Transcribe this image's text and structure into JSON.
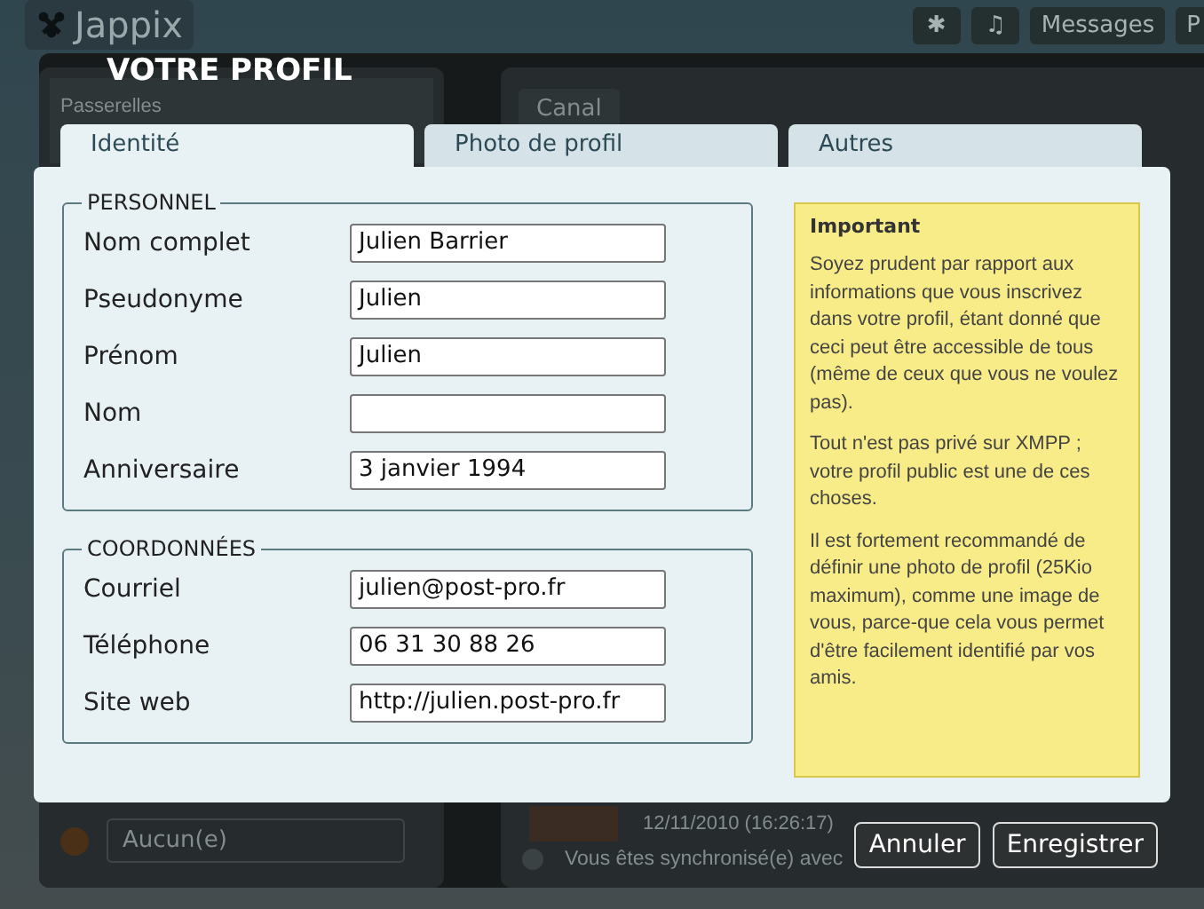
{
  "background_app": {
    "logo": "Jappix",
    "toolbar": [
      {
        "kind": "icon",
        "label": "✱"
      },
      {
        "kind": "icon",
        "label": "♫"
      },
      {
        "kind": "text",
        "label": "Messages"
      },
      {
        "kind": "text",
        "label": "P"
      }
    ],
    "left_panel": {
      "section": "Passerelles",
      "presence_select": "Aucun(e)"
    },
    "right_panel": {
      "tab": "Canal",
      "timestamp": "12/11/2010 (16:26:17)",
      "status": "Vous êtes synchronisé(e) avec"
    }
  },
  "dialog": {
    "title": "VOTRE PROFIL",
    "tabs": [
      {
        "label": "Identité",
        "selected": true
      },
      {
        "label": "Photo de profil",
        "selected": false
      },
      {
        "label": "Autres",
        "selected": false
      }
    ],
    "fieldsets": [
      {
        "legend": "PERSONNEL",
        "fields": [
          {
            "label": "Nom complet",
            "value": "Julien Barrier"
          },
          {
            "label": "Pseudonyme",
            "value": "Julien"
          },
          {
            "label": "Prénom",
            "value": "Julien"
          },
          {
            "label": "Nom"
          },
          {
            "label": "Anniversaire",
            "value": "3 janvier 1994"
          }
        ]
      },
      {
        "legend": "COORDONNÉES",
        "fields": [
          {
            "label": "Courriel",
            "value": "julien@post-pro.fr"
          },
          {
            "label": "Téléphone",
            "value": "06 31 30 88 26"
          },
          {
            "label": "Site web",
            "value": "http://julien.post-pro.fr"
          }
        ]
      }
    ],
    "notice": {
      "title": "Important",
      "paragraphs": [
        "Soyez prudent par rapport aux informations que vous inscrivez dans votre profil, étant donné que ceci peut être accessible de tous (même de ceux que vous ne voulez pas).",
        "Tout n'est pas privé sur XMPP ; votre profil public est une de ces choses.",
        "Il est fortement recommandé de définir une photo de profil (25Kio maximum), comme une image de vous, parce-que cela vous permet d'être facilement identifié par vos amis."
      ]
    },
    "buttons": [
      "Annuler",
      "Enregistrer"
    ]
  }
}
